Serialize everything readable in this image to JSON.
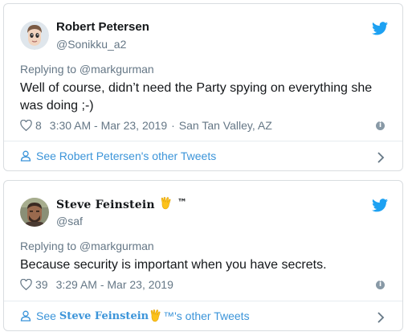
{
  "tweets": [
    {
      "display_name": "Robert Petersen",
      "handle": "@Sonikku_a2",
      "replying_to": "Replying to @markgurman",
      "text": "Well of course, didn’t need the Party spying on everything she was doing ;-)",
      "likes": "8",
      "timestamp": "3:30 AM - Mar 23, 2019",
      "location_sep": "·",
      "location": "San Tan Valley, AZ",
      "see_more": "See Robert Petersen's other Tweets"
    },
    {
      "display_name": "Steve Feinstein",
      "name_suffix": "™",
      "handle": "@saf",
      "replying_to": "Replying to @markgurman",
      "text": "Because security is important when you have secrets.",
      "likes": "39",
      "timestamp": "3:29 AM - Mar 23, 2019",
      "see_more_prefix": "See",
      "see_more_name": "Steve Feinstein",
      "see_more_suffix": "™'s other Tweets"
    }
  ],
  "icons": {
    "twitter": "twitter-bird-icon",
    "heart": "heart-icon",
    "info": "info-icon",
    "person": "person-icon",
    "chevron": "chevron-right-icon",
    "vulcan": "vulcan-salute-emoji"
  },
  "colors": {
    "twitter_blue": "#1da1f2",
    "link_blue": "#3b94d9",
    "muted": "#657786",
    "border": "#d9dde0"
  }
}
